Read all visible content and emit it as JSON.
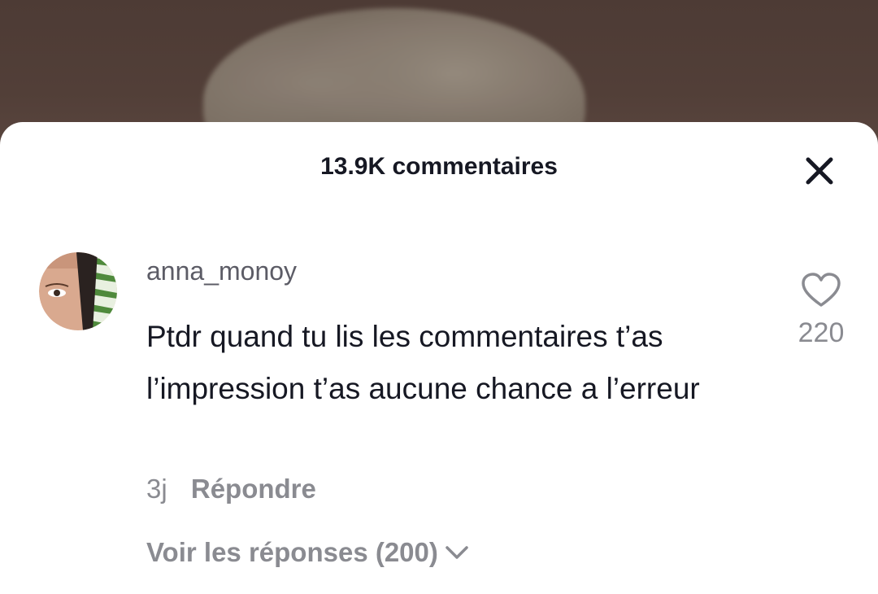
{
  "header": {
    "title": "13.9K commentaires"
  },
  "comment": {
    "username": "anna_monoy",
    "text": "Ptdr quand tu lis les commentaires t’as l’impression t’as aucune chance a l’erreur",
    "age": "3j",
    "reply_label": "Répondre",
    "likes": "220",
    "view_replies_label": "Voir les réponses (200)"
  },
  "icons": {
    "close": "close-icon",
    "like": "heart-outline-icon",
    "expand": "chevron-down-icon"
  },
  "colors": {
    "text_primary": "#161823",
    "text_secondary": "#8a8b91",
    "background": "#ffffff"
  }
}
